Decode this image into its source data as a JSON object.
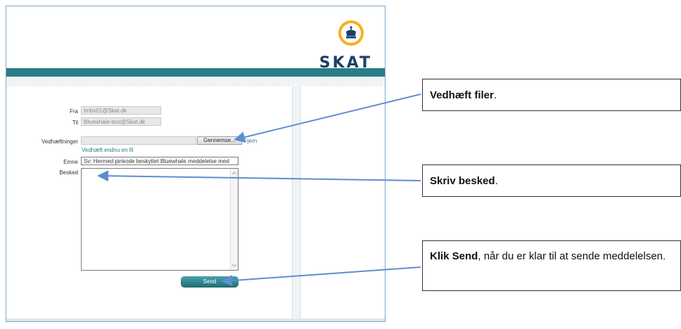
{
  "logo": {
    "text": "SKAT"
  },
  "form": {
    "from_label": "Fra",
    "from_value": "tmbx01@Skat.dk",
    "to_label": "Til",
    "to_value": "Bluewhale-test@Skat.dk",
    "attachments_label": "Vedhæftninger",
    "browse_button": "Gennemse...",
    "remove_link": "Fjern",
    "attach_more_link": "Vedhæft endnu en fil",
    "subject_label": "Emne",
    "subject_value": "Sv: Hermed pinkode beskyttet Bluewhale meddelelse med",
    "message_label": "Besked",
    "send_button": "Send"
  },
  "callouts": {
    "attach_bold": "Vedhæft filer",
    "attach_rest": ".",
    "write_bold": "Skriv besked",
    "write_rest": ".",
    "send_bold": "Klik Send",
    "send_rest": ", når du er klar til at sende meddelelsen."
  },
  "colors": {
    "teal": "#2a7d85",
    "arrow": "#5b8fd1",
    "logo_gold": "#f6b11a",
    "logo_navy": "#1d3f6a"
  },
  "icons": {
    "logo": "crown-emblem-icon",
    "scroll_down": "chevron-down-icon",
    "scroll_up": "chevron-up-icon"
  }
}
